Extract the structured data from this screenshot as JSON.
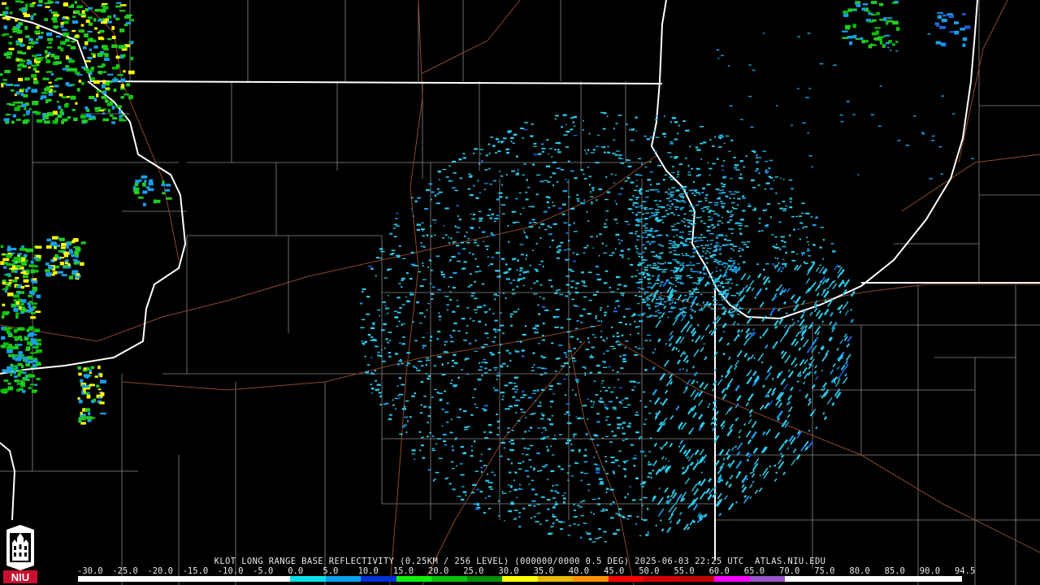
{
  "product": {
    "title": "KLOT LONG RANGE BASE REFLECTIVITY (0.25KM / 256 LEVEL) (000000/0000 0.5 DEG) 2025-06-03 22:25 UTC  ATLAS.NIU.EDU",
    "station": "KLOT",
    "timestamp": "2025-06-03 22:25 UTC",
    "elevation": "0.5 DEG",
    "source": "ATLAS.NIU.EDU"
  },
  "scale": {
    "labels": [
      "-30.0",
      "-25.0",
      "-20.0",
      "-15.0",
      "-10.0",
      "-5.0",
      "0.0",
      "5.0",
      "10.0",
      "15.0",
      "20.0",
      "25.0",
      "30.0",
      "35.0",
      "40.0",
      "45.0",
      "50.0",
      "55.0",
      "60.0",
      "65.0",
      "70.0",
      "75.0",
      "80.0",
      "85.0",
      "90.0",
      "94.5"
    ],
    "colors": [
      "#ffffff",
      "#ffffff",
      "#ffffff",
      "#ffffff",
      "#ffffff",
      "#ffffff",
      "#05e1e6",
      "#0ca0ee",
      "#0030d8",
      "#0cf20c",
      "#0ac00a",
      "#089008",
      "#ffff00",
      "#e6b800",
      "#ff9000",
      "#ff0000",
      "#d40000",
      "#c00000",
      "#ff00ff",
      "#9955c9",
      "#ffffff",
      "#ffffff",
      "#ffffff",
      "#ffffff",
      "#ffffff"
    ]
  },
  "logo": {
    "text": "NIU"
  },
  "colors": {
    "state_border": "#ffffff",
    "county_border": "#8a8a8a",
    "road": "#8b4a2b",
    "radar_light": "#2fc7e6",
    "radar_mid": "#1a9ee8",
    "radar_blue": "#1f5fd6",
    "storm_green": "#22cc22",
    "storm_yellow": "#ffff00"
  }
}
